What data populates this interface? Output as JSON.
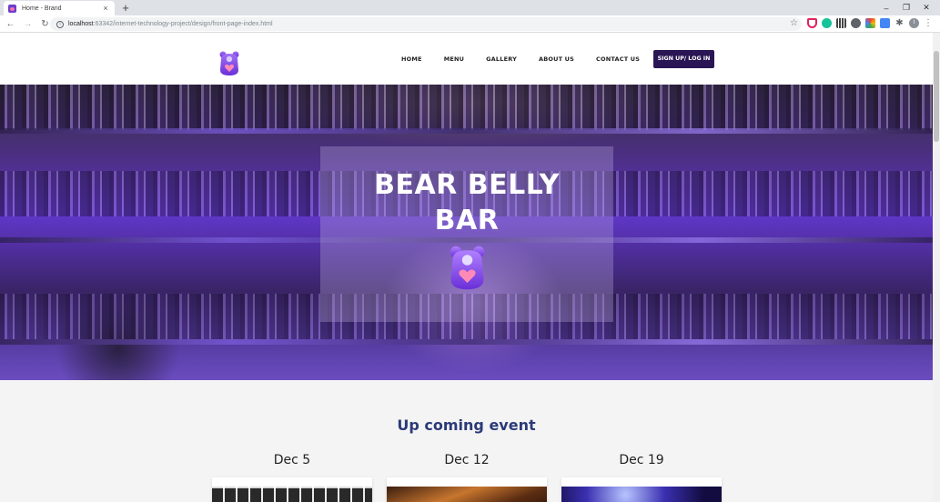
{
  "browser": {
    "tab_title": "Home - Brand",
    "tab_close": "×",
    "new_tab": "+",
    "url_host": "localhost",
    "url_path": ":63342/internet-technology-project/design/front-page-index.html",
    "window_minimize": "–",
    "window_restore": "❐",
    "window_close": "✕",
    "profile_initial": "I"
  },
  "nav": {
    "items": [
      {
        "label": "HOME"
      },
      {
        "label": "MENU"
      },
      {
        "label": "GALLERY"
      },
      {
        "label": "ABOUT US"
      },
      {
        "label": "CONTACT US"
      }
    ],
    "signup_label": "SIGN UP/ LOG IN"
  },
  "hero": {
    "title_line1": "BEAR BELLY",
    "title_line2": "BAR"
  },
  "events": {
    "title": "Up coming event",
    "items": [
      {
        "date": "Dec 5"
      },
      {
        "date": "Dec 12"
      },
      {
        "date": "Dec 19"
      }
    ]
  },
  "colors": {
    "brand_purple": "#7b3fe4",
    "brand_pink": "#ff7bb0",
    "signup_bg": "#2a1654",
    "events_title": "#2b3a78"
  }
}
